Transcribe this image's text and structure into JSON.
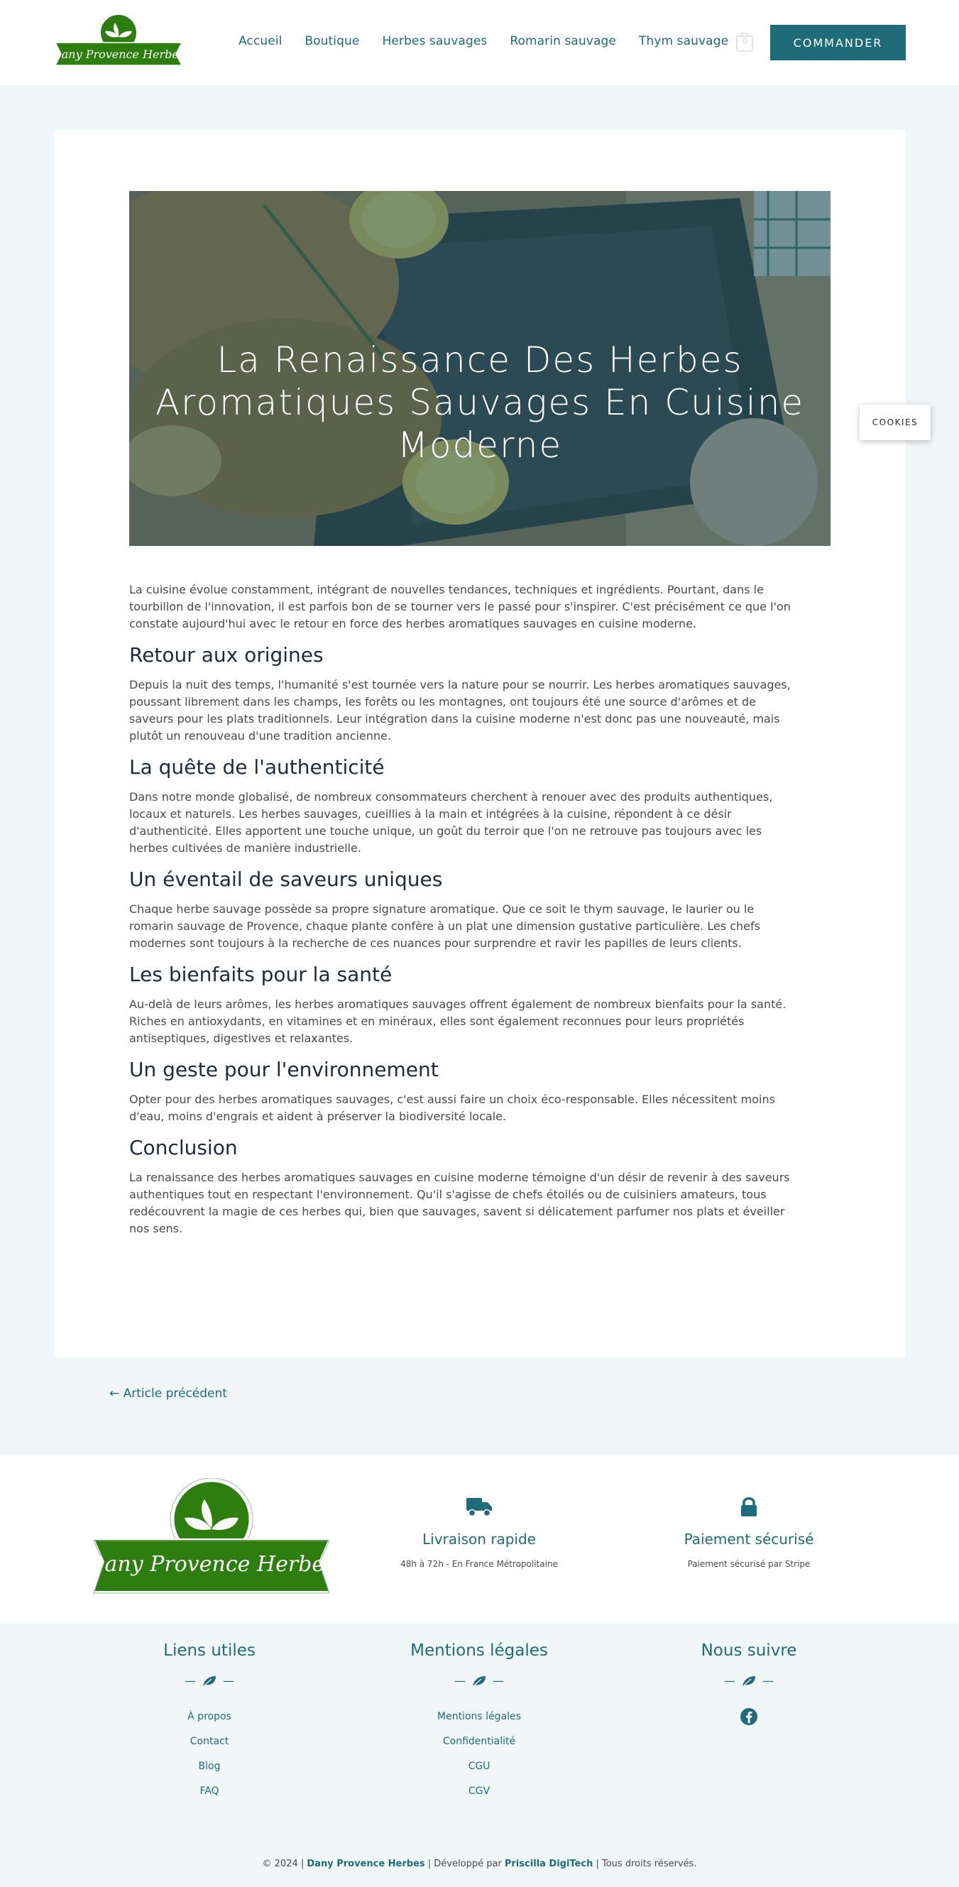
{
  "header": {
    "logo_text": "Dany Provence Herbes",
    "nav": [
      "Accueil",
      "Boutique",
      "Herbes sauvages",
      "Romarin sauvage",
      "Thym sauvage"
    ],
    "cart_count": "0",
    "order_button": "COMMANDER"
  },
  "article": {
    "title": "La Renaissance Des Herbes Aromatiques Sauvages En Cuisine Moderne",
    "intro": "La cuisine évolue constamment, intégrant de nouvelles tendances, techniques et ingrédients. Pourtant, dans le tourbillon de l'innovation, il est parfois bon de se tourner vers le passé pour s'inspirer. C'est précisément ce que l'on constate aujourd'hui avec le retour en force des herbes aromatiques sauvages en cuisine moderne.",
    "sections": [
      {
        "heading": "Retour aux origines",
        "text": "Depuis la nuit des temps, l'humanité s'est tournée vers la nature pour se nourrir. Les herbes aromatiques sauvages, poussant librement dans les champs, les forêts ou les montagnes, ont toujours été une source d'arômes et de saveurs pour les plats traditionnels. Leur intégration dans la cuisine moderne n'est donc pas une nouveauté, mais plutôt un renouveau d'une tradition ancienne."
      },
      {
        "heading": "La quête de l'authenticité",
        "text": "Dans notre monde globalisé, de nombreux consommateurs cherchent à renouer avec des produits authentiques, locaux et naturels. Les herbes sauvages, cueillies à la main et intégrées à la cuisine, répondent à ce désir d'authenticité. Elles apportent une touche unique, un goût du terroir que l'on ne retrouve pas toujours avec les herbes cultivées de manière industrielle."
      },
      {
        "heading": "Un éventail de saveurs uniques",
        "text": "Chaque herbe sauvage possède sa propre signature aromatique. Que ce soit le thym sauvage, le laurier ou le romarin sauvage de Provence, chaque plante confère à un plat une dimension gustative particulière. Les chefs modernes sont toujours à la recherche de ces nuances pour surprendre et ravir les papilles de leurs clients."
      },
      {
        "heading": "Les bienfaits pour la santé",
        "text": "Au-delà de leurs arômes, les herbes aromatiques sauvages offrent également de nombreux bienfaits pour la santé. Riches en antioxydants, en vitamines et en minéraux, elles sont également reconnues pour leurs propriétés antiseptiques, digestives et relaxantes."
      },
      {
        "heading": "Un geste pour l'environnement",
        "text": "Opter pour des herbes aromatiques sauvages, c'est aussi faire un choix éco-responsable. Elles nécessitent moins d'eau, moins d'engrais et aident à préserver la biodiversité locale."
      },
      {
        "heading": "Conclusion",
        "text": "La renaissance des herbes aromatiques sauvages en cuisine moderne témoigne d'un désir de revenir à des saveurs authentiques tout en respectant l'environnement. Qu'il s'agisse de chefs étoilés ou de cuisiniers amateurs, tous redécouvrent la magie de ces herbes qui, bien que sauvages, savent si délicatement parfumer nos plats et éveiller nos sens."
      }
    ],
    "prev_link": "← Article précédent"
  },
  "cookies_label": "COOKIES",
  "footer": {
    "features": [
      {
        "icon": "truck-icon",
        "title": "Livraison rapide",
        "text": "48h à 72h - En France Métropolitaine"
      },
      {
        "icon": "lock-icon",
        "title": "Paiement sécurisé",
        "text": "Paiement sécurisé par Stripe"
      }
    ],
    "columns": [
      {
        "title": "Liens utiles",
        "links": [
          "À propos",
          "Contact",
          "Blog",
          "FAQ"
        ]
      },
      {
        "title": "Mentions légales",
        "links": [
          "Mentions légales",
          "Confidentialité",
          "CGU",
          "CGV"
        ]
      },
      {
        "title": "Nous suivre",
        "social": "facebook-icon"
      }
    ],
    "copyright": {
      "prefix": "© 2024 | ",
      "brand": "Dany Provence Herbes",
      "middle": " | Développé par ",
      "dev": "Priscilla DigiTech",
      "suffix": " | Tous droits réservés."
    }
  },
  "colors": {
    "accent": "#1e6b7a",
    "logo_green": "#2e7d0f",
    "page_bg": "#f1f6f8"
  }
}
